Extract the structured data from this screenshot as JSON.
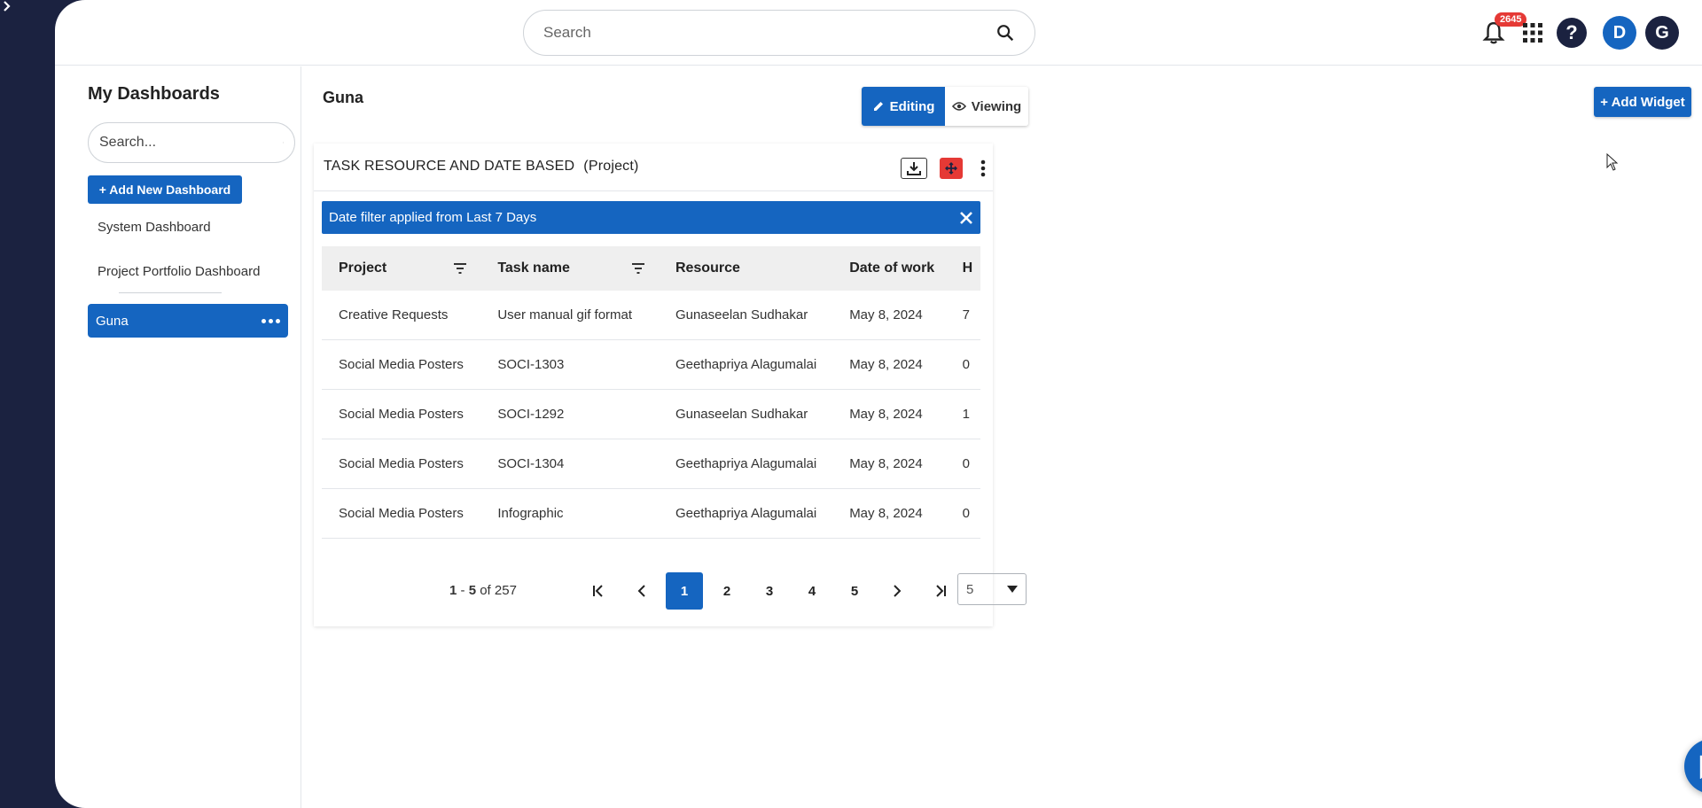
{
  "header": {
    "search_placeholder": "Search",
    "notification_count": "2645",
    "avatars": [
      {
        "initial": "D",
        "color": "#1565c0"
      },
      {
        "initial": "G",
        "color": "#1b2240"
      }
    ]
  },
  "rail": {
    "icons": [
      "presentation-icon",
      "trend-icon",
      "dashboard-icon",
      "widgets-icon",
      "edit-note-icon",
      "book-icon",
      "drive-add-icon",
      "calendar-icon",
      "waveform-icon",
      "calendar-check-icon"
    ]
  },
  "sidebar": {
    "title": "My Dashboards",
    "search_placeholder": "Search...",
    "add_button": "+ Add New Dashboard",
    "items": [
      {
        "label": "System Dashboard"
      },
      {
        "label": "Project Portfolio Dashboard"
      }
    ],
    "active_item": "Guna"
  },
  "main": {
    "title": "Guna",
    "mode_toggle": {
      "editing": "Editing",
      "viewing": "Viewing",
      "selected": "editing"
    },
    "add_widget": "+ Add Widget"
  },
  "widget": {
    "title": "TASK RESOURCE AND DATE BASED",
    "subtitle": "(Project)",
    "filter_banner": "Date filter applied from Last 7 Days",
    "columns": [
      "Project",
      "Task name",
      "Resource",
      "Date of work",
      "H"
    ],
    "rows": [
      [
        "Creative Requests",
        "User manual gif format",
        "Gunaseelan Sudhakar",
        "May 8, 2024",
        "7"
      ],
      [
        "Social Media Posters",
        "SOCI-1303",
        "Geethapriya Alagumalai",
        "May 8, 2024",
        "0"
      ],
      [
        "Social Media Posters",
        "SOCI-1292",
        "Gunaseelan Sudhakar",
        "May 8, 2024",
        "1"
      ],
      [
        "Social Media Posters",
        "SOCI-1304",
        "Geethapriya Alagumalai",
        "May 8, 2024",
        "0"
      ],
      [
        "Social Media Posters",
        "Infographic",
        "Geethapriya Alagumalai",
        "May 8, 2024",
        "0"
      ]
    ],
    "pagination": {
      "range_start": "1",
      "range_sep": " - ",
      "range_end": "5",
      "of_label": " of ",
      "total": "257",
      "pages": [
        "1",
        "2",
        "3",
        "4",
        "5"
      ],
      "current_page": "1",
      "page_size": "5"
    }
  },
  "colors": {
    "primary": "#1565c0",
    "rail": "#1b2240",
    "danger": "#e53935"
  }
}
